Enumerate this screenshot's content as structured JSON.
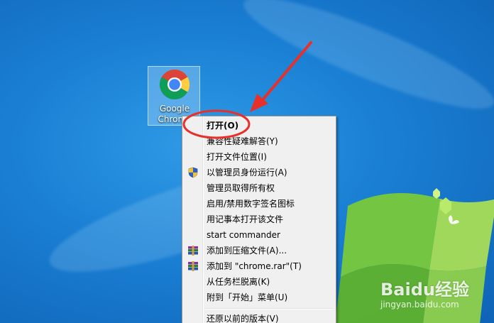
{
  "desktop": {
    "icon": {
      "label": "Google\nChrome",
      "icon": "chrome-icon"
    }
  },
  "context_menu": {
    "items": [
      {
        "label": "打开(O)",
        "bold": true,
        "icon": null
      },
      {
        "label": "兼容性疑难解答(Y)",
        "icon": null
      },
      {
        "label": "打开文件位置(I)",
        "icon": null
      },
      {
        "label": "以管理员身份运行(A)",
        "icon": "uac-shield-icon"
      },
      {
        "label": "管理员取得所有权",
        "icon": null
      },
      {
        "label": "启用/禁用数字签名图标",
        "icon": null
      },
      {
        "label": "用记事本打开该文件",
        "icon": null
      },
      {
        "label": "start commander",
        "icon": null
      },
      {
        "label": "添加到压缩文件(A)...",
        "icon": "winrar-icon"
      },
      {
        "label": "添加到 \"chrome.rar\"(T)",
        "icon": "winrar-icon"
      },
      {
        "label": "从任务栏脱离(K)",
        "icon": null
      },
      {
        "label": "附到「开始」菜单(U)",
        "icon": null
      },
      {
        "label": "还原以前的版本(V)",
        "icon": null
      }
    ]
  },
  "watermark": {
    "brand": "Baidu经验",
    "site": "jingyan.baidu.com"
  },
  "colors": {
    "desktop_blue": "#1a7fd3",
    "annotation_red": "#e8302a",
    "menu_bg": "#f0f0f0"
  }
}
